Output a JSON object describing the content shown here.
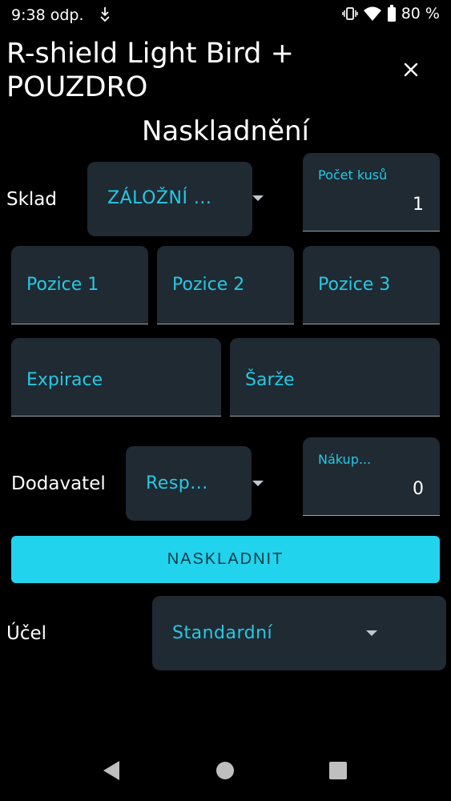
{
  "status_bar": {
    "time": "9:38 odp.",
    "battery": "80 %"
  },
  "header": {
    "title": "R-shield Light Bird + POUZDRO",
    "close_icon": "close-icon"
  },
  "page": {
    "heading": "Naskladnění"
  },
  "form": {
    "sklad_label": "Sklad",
    "sklad_value": "ZÁLOŽNÍ ...",
    "pocet_label": "Počet kusů",
    "pocet_value": "1",
    "pozice1": "Pozice 1",
    "pozice2": "Pozice 2",
    "pozice3": "Pozice 3",
    "expirace": "Expirace",
    "sarze": "Šarže",
    "dodavatel_label": "Dodavatel",
    "dodavatel_value": "Resp...",
    "nakup_label": "Nákup...",
    "nakup_value": "0",
    "submit_label": "NASKLADNIT",
    "ucel_label": "Účel",
    "ucel_value": "Standardní"
  },
  "colors": {
    "accent": "#22d3ee",
    "field_bg": "#1f2a33",
    "field_text": "#27c8e3"
  }
}
